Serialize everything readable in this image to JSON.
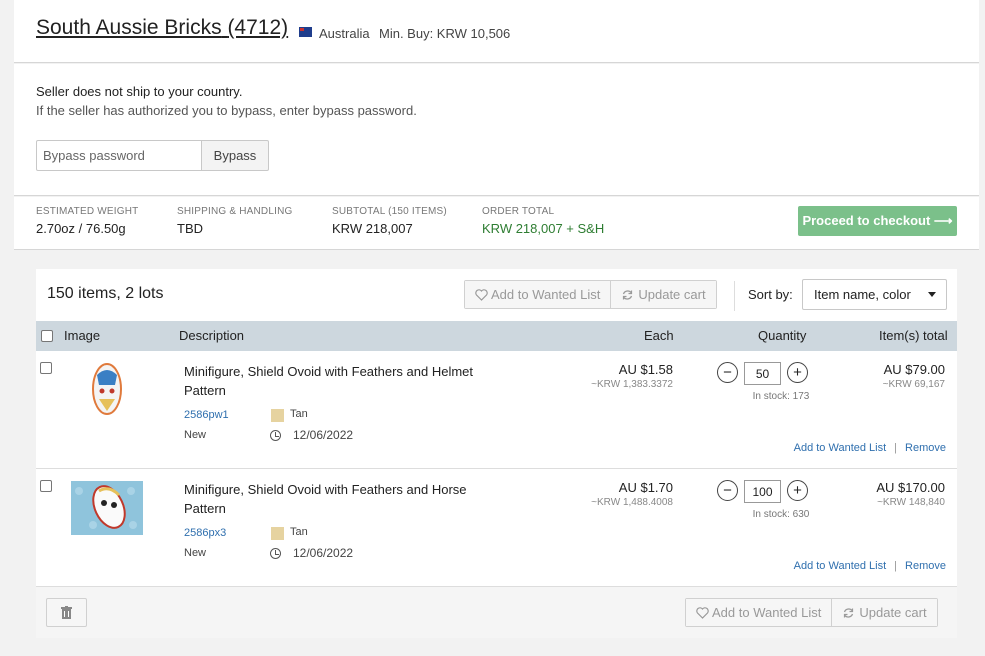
{
  "store": {
    "name": "South Aussie Bricks",
    "feedback": "(4712)",
    "country": "Australia",
    "min_buy": "Min. Buy: KRW 10,506"
  },
  "shipping": {
    "notice": "Seller does not ship to your country.",
    "hint": "If the seller has authorized you to bypass, enter bypass password.",
    "placeholder": "Bypass password",
    "button": "Bypass"
  },
  "summary": {
    "weight_label": "ESTIMATED WEIGHT",
    "weight_value": "2.70oz / 76.50g",
    "shipping_label": "SHIPPING & HANDLING",
    "shipping_value": "TBD",
    "subtotal_label": "SUBTOTAL (150 ITEMS)",
    "subtotal_value": "KRW 218,007",
    "total_label": "ORDER TOTAL",
    "total_value": "KRW 218,007 + S&H",
    "checkout": "Proceed to checkout ⟶"
  },
  "cart": {
    "count": "150 items, 2 lots",
    "add_wanted": "Add to Wanted List",
    "update_cart": "Update cart",
    "sort_label": "Sort by:",
    "sort_value": "Item name, color",
    "columns": {
      "image": "Image",
      "description": "Description",
      "each": "Each",
      "quantity": "Quantity",
      "total": "Item(s) total"
    },
    "items": [
      {
        "description": "Minifigure, Shield Ovoid with Feathers and Helmet Pattern",
        "code": "2586pw1",
        "color": "Tan",
        "condition": "New",
        "date": "12/06/2022",
        "each": "AU $1.58",
        "each_krw": "~KRW 1,383.3372",
        "qty": "50",
        "stock": "In stock: 173",
        "total": "AU $79.00",
        "total_krw": "~KRW 69,167",
        "add_wanted": "Add to Wanted List",
        "remove": "Remove"
      },
      {
        "description": "Minifigure, Shield Ovoid with Feathers and Horse Pattern",
        "code": "2586px3",
        "color": "Tan",
        "condition": "New",
        "date": "12/06/2022",
        "each": "AU $1.70",
        "each_krw": "~KRW 1,488.4008",
        "qty": "100",
        "stock": "In stock: 630",
        "total": "AU $170.00",
        "total_krw": "~KRW 148,840",
        "add_wanted": "Add to Wanted List",
        "remove": "Remove"
      }
    ],
    "separator": "|"
  },
  "colors": {
    "checkout_green": "#7bc08a",
    "total_green": "#2e7d32",
    "link_blue": "#2f6fae",
    "header_band": "#cdd7de",
    "tan_swatch": "#e6d3a0"
  },
  "icons": [
    "flag-au-icon",
    "heart-icon",
    "refresh-icon",
    "caret-down-icon",
    "clock-icon",
    "minus-icon",
    "plus-icon",
    "trash-icon"
  ]
}
